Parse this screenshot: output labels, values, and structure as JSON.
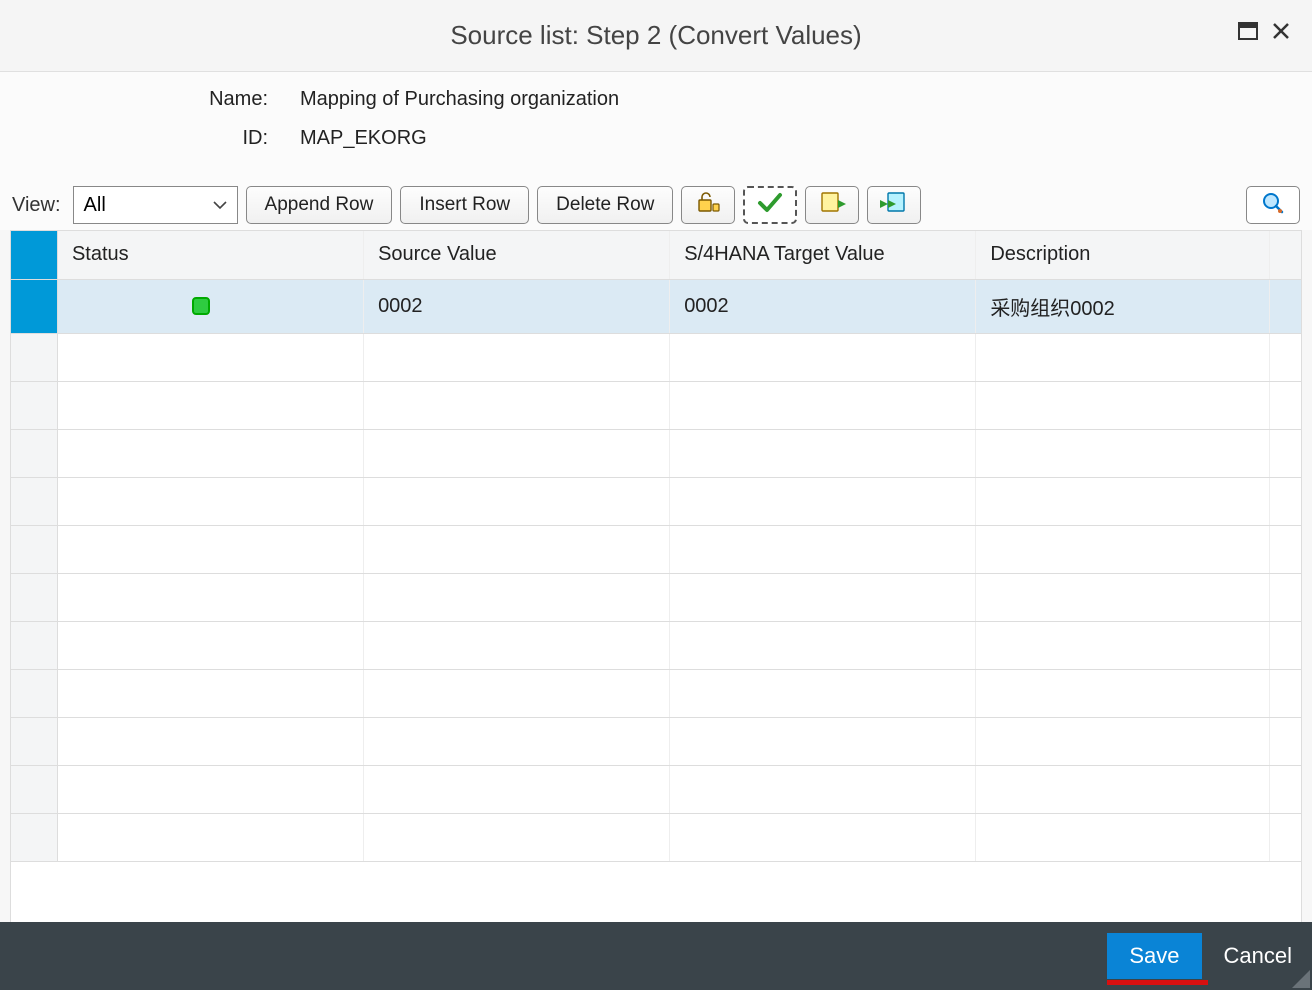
{
  "window": {
    "title": "Source list: Step 2 (Convert Values)"
  },
  "form": {
    "name_label": "Name:",
    "name_value": "Mapping of Purchasing organization",
    "id_label": "ID:",
    "id_value": "MAP_EKORG"
  },
  "toolbar": {
    "view_label": "View:",
    "view_selected": "All",
    "append_row": "Append Row",
    "insert_row": "Insert Row",
    "delete_row": "Delete Row",
    "icon_buttons": [
      "unlock",
      "check",
      "export",
      "import"
    ],
    "search_icon": "search"
  },
  "table": {
    "columns": [
      "Status",
      "Source Value",
      "S/4HANA Target Value",
      "Description"
    ],
    "rows": [
      {
        "status": "ok",
        "source_value": "0002",
        "target_value": "0002",
        "description": "采购组织0002",
        "selected": true
      }
    ],
    "empty_row_count": 11
  },
  "footer": {
    "save": "Save",
    "cancel": "Cancel"
  }
}
